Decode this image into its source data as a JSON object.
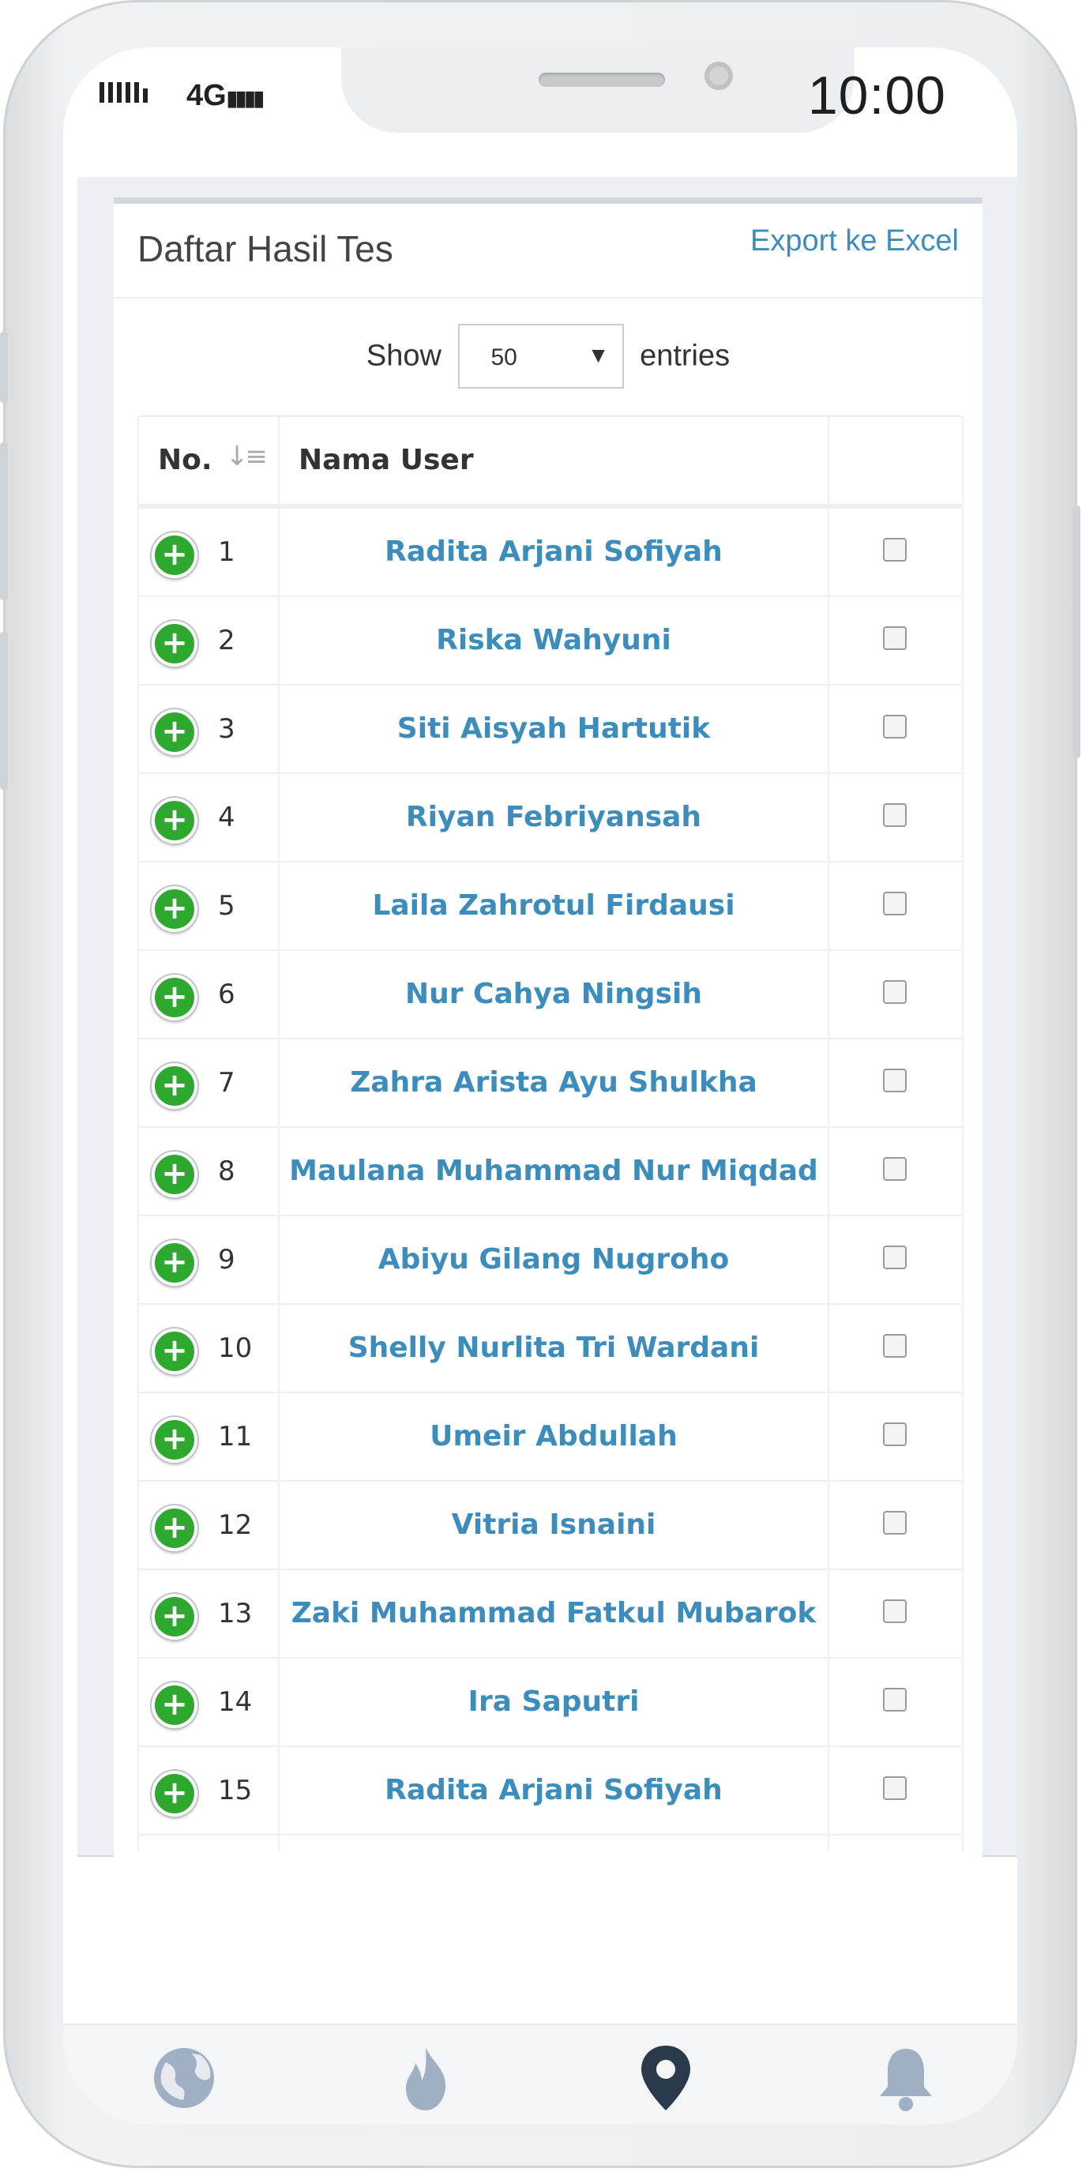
{
  "status_bar": {
    "network": "4G",
    "time": "10:00"
  },
  "page": {
    "title": "Daftar Hasil Tes",
    "export_label": "Export ke Excel"
  },
  "entries_control": {
    "show_label": "Show",
    "selected": "50",
    "entries_label": "entries"
  },
  "table": {
    "headers": {
      "no": "No.",
      "name": "Nama User"
    },
    "rows": [
      {
        "no": "1",
        "name": "Radita Arjani Sofiyah"
      },
      {
        "no": "2",
        "name": "Riska Wahyuni"
      },
      {
        "no": "3",
        "name": "Siti Aisyah Hartutik"
      },
      {
        "no": "4",
        "name": "Riyan Febriyansah"
      },
      {
        "no": "5",
        "name": "Laila Zahrotul Firdausi"
      },
      {
        "no": "6",
        "name": "Nur Cahya Ningsih"
      },
      {
        "no": "7",
        "name": "Zahra Arista Ayu Shulkha"
      },
      {
        "no": "8",
        "name": "Maulana Muhammad Nur Miqdad"
      },
      {
        "no": "9",
        "name": "Abiyu Gilang Nugroho"
      },
      {
        "no": "10",
        "name": "Shelly Nurlita Tri Wardani"
      },
      {
        "no": "11",
        "name": "Umeir Abdullah"
      },
      {
        "no": "12",
        "name": "Vitria Isnaini"
      },
      {
        "no": "13",
        "name": "Zaki Muhammad Fatkul Mubarok"
      },
      {
        "no": "14",
        "name": "Ira Saputri"
      },
      {
        "no": "15",
        "name": "Radita Arjani Sofiyah"
      }
    ]
  },
  "bottom_nav": [
    {
      "icon": "globe-icon"
    },
    {
      "icon": "flame-icon"
    },
    {
      "icon": "location-pin-icon"
    },
    {
      "icon": "bell-icon"
    }
  ],
  "colors": {
    "link": "#3c8dbc",
    "expand_button": "#2ea82e",
    "content_bg": "#ecf0f5",
    "nav_active": "#2b3a4a",
    "nav_inactive": "#9fb0c4"
  }
}
